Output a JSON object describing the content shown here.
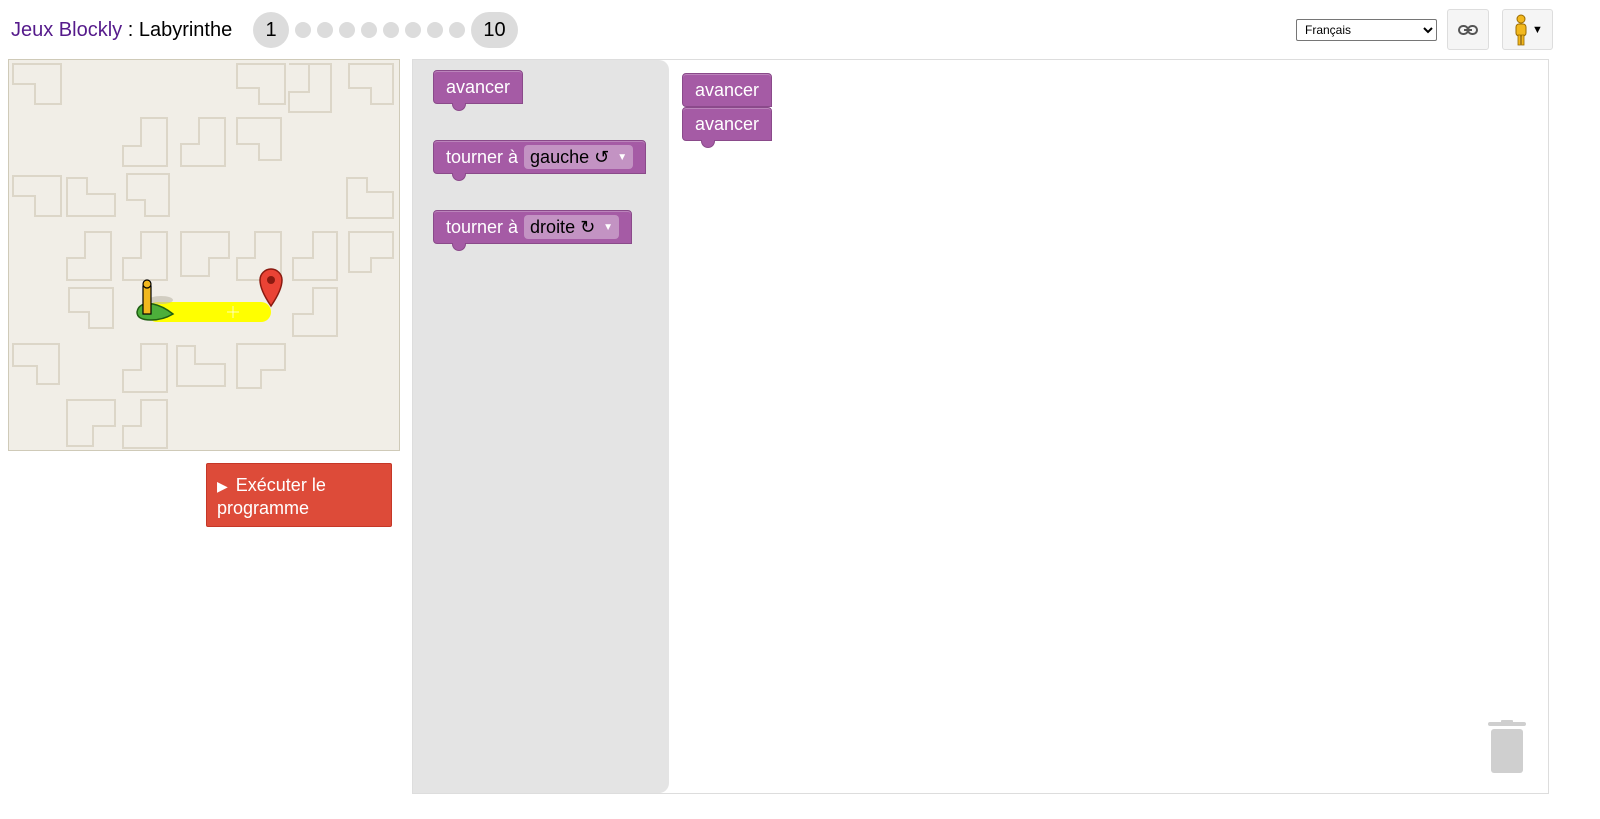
{
  "header": {
    "brand": "Jeux Blockly",
    "separator": " : ",
    "game": "Labyrinthe",
    "levels": {
      "first": "1",
      "last": "10",
      "current": 1
    }
  },
  "language": {
    "selected": "Français",
    "options": [
      "Français"
    ]
  },
  "icons": {
    "link": "link-icon",
    "pegman": "pegman-icon",
    "trash": "trash-icon",
    "run": "play-icon"
  },
  "run_button": {
    "label": "Exécuter le programme"
  },
  "toolbox": {
    "move_forward": "avancer",
    "turn_left_prefix": "tourner à",
    "turn_left_value": "gauche ↺",
    "turn_right_prefix": "tourner à",
    "turn_right_value": "droite ↻"
  },
  "workspace": {
    "block1": "avancer",
    "block2": "avancer"
  },
  "colors": {
    "block": "#a55ba5",
    "run_button": "#dd4b39",
    "brand_link": "#551a8b",
    "path": "#ffff00"
  }
}
